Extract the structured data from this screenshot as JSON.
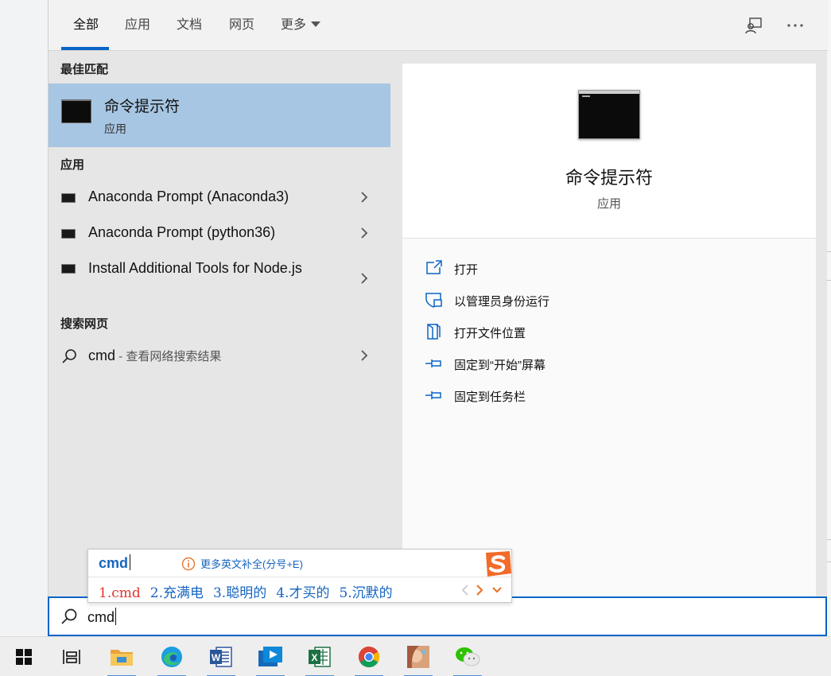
{
  "tabs": [
    {
      "label": "全部",
      "active": true
    },
    {
      "label": "应用",
      "active": false
    },
    {
      "label": "文档",
      "active": false
    },
    {
      "label": "网页",
      "active": false
    },
    {
      "label": "更多",
      "active": false
    }
  ],
  "top_icons": {
    "feedback": "feedback-icon",
    "more": "more-options-icon"
  },
  "left": {
    "best_match_header": "最佳匹配",
    "best_match": {
      "title": "命令提示符",
      "subtitle": "应用",
      "icon": "cmd-icon"
    },
    "apps_header": "应用",
    "apps": [
      {
        "label": "Anaconda Prompt (Anaconda3)",
        "icon": "terminal-icon"
      },
      {
        "label": "Anaconda Prompt (python36)",
        "icon": "terminal-icon"
      },
      {
        "label": "Install Additional Tools for Node.js",
        "icon": "terminal-icon"
      }
    ],
    "web_header": "搜索网页",
    "web_result": {
      "query": "cmd",
      "suffix": " - 查看网络搜索结果",
      "icon": "search-icon"
    }
  },
  "right": {
    "title": "命令提示符",
    "subtitle": "应用",
    "actions": [
      {
        "label": "打开",
        "icon": "open-icon"
      },
      {
        "label": "以管理员身份运行",
        "icon": "shield-icon"
      },
      {
        "label": "打开文件位置",
        "icon": "file-location-icon"
      },
      {
        "label": "固定到“开始”屏幕",
        "icon": "pin-icon"
      },
      {
        "label": "固定到任务栏",
        "icon": "pin-icon"
      }
    ]
  },
  "search": {
    "value": "cmd"
  },
  "ime": {
    "composition": "cmd",
    "hint": "更多英文补全(分号+E)",
    "candidates": [
      "1.cmd",
      "2.充满电",
      "3.聪明的",
      "4.才买的",
      "5.沉默的"
    ]
  },
  "taskbar": {
    "items": [
      "windows-start-icon",
      "task-view-icon",
      "file-explorer-icon",
      "edge-icon",
      "word-icon",
      "media-player-icon",
      "excel-icon",
      "chrome-icon",
      "photo-app-icon",
      "wechat-icon"
    ]
  },
  "colors": {
    "accent": "#0a64c8",
    "selection": "#a7c6e3",
    "ime_blue": "#1565c0",
    "ime_red": "#e0352b"
  }
}
